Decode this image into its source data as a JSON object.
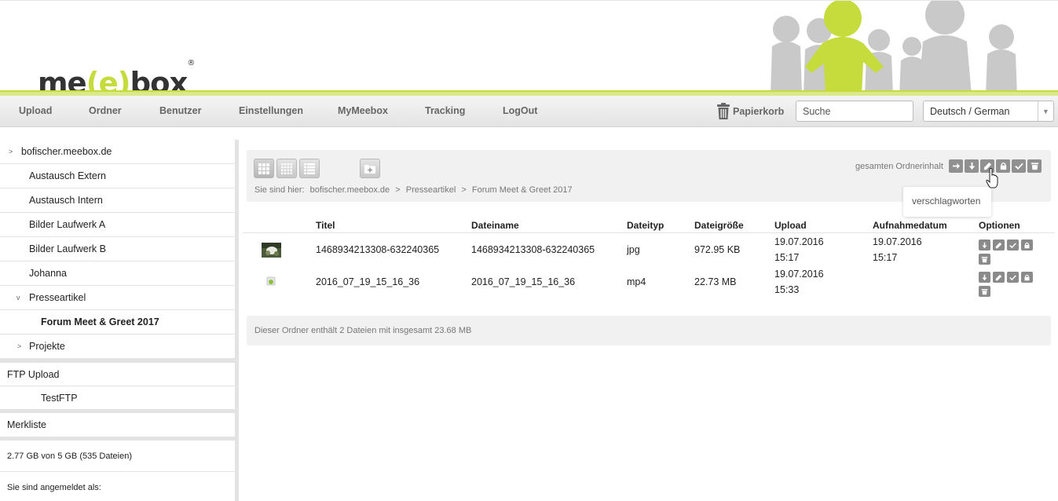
{
  "brand": {
    "logo_part1": "me",
    "logo_part2": "(e)",
    "logo_part3": "box",
    "logo_mark": "®",
    "accent_color": "#c6dc3c"
  },
  "nav": {
    "items": [
      "Upload",
      "Ordner",
      "Benutzer",
      "Einstellungen",
      "MyMeebox",
      "Tracking",
      "LogOut"
    ],
    "trash_label": "Papierkorb",
    "trash_icon": "trash-icon",
    "search_placeholder": "Suche",
    "language_value": "Deutsch / German"
  },
  "sidebar": {
    "root": "bofischer.meebox.de",
    "folders": [
      "Austausch Extern",
      "Austausch Intern",
      "Bilder Laufwerk A",
      "Bilder Laufwerk B",
      "Johanna",
      "Presseartikel",
      "Forum Meet & Greet 2017",
      "Projekte"
    ],
    "ftp_label": "FTP Upload",
    "ftp_child": "TestFTP",
    "merkliste": "Merkliste",
    "storage": "2.77 GB von 5 GB (535 Dateien)",
    "logged_in_label": "Sie sind angemeldet als:"
  },
  "toolbar": {
    "view_buttons": [
      "grid-large-icon",
      "grid-small-icon",
      "list-icon"
    ],
    "new_folder_icon": "folder-add-icon",
    "breadcrumb_prefix": "Sie sind hier:",
    "breadcrumb": [
      "bofischer.meebox.de",
      "Presseartikel",
      "Forum Meet & Greet 2017"
    ],
    "breadcrumb_sep": ">",
    "all_content_label": "gesamten Ordnerinhalt",
    "actions": [
      "move-icon",
      "download-icon",
      "edit-icon",
      "lock-icon",
      "check-icon",
      "delete-icon"
    ],
    "tooltip": "verschlagworten"
  },
  "table": {
    "columns": [
      "Titel",
      "Dateiname",
      "Dateityp",
      "Dateigröße",
      "Upload",
      "Aufnahmedatum",
      "Optionen"
    ],
    "rows": [
      {
        "thumb": "image-thumbnail",
        "title": "1468934213308-632240365",
        "filename": "1468934213308-632240365",
        "type": "jpg",
        "size": "972.95 KB",
        "upload_date": "19.07.2016",
        "upload_time": "15:17",
        "capture_date": "19.07.2016",
        "capture_time": "15:17"
      },
      {
        "thumb": "video-file-icon",
        "title": "2016_07_19_15_16_36",
        "filename": "2016_07_19_15_16_36",
        "type": "mp4",
        "size": "22.73 MB",
        "upload_date": "19.07.2016",
        "upload_time": "15:33",
        "capture_date": "",
        "capture_time": ""
      }
    ],
    "row_actions": [
      "download-icon",
      "edit-icon",
      "check-icon",
      "lock-icon",
      "delete-icon"
    ]
  },
  "footer": {
    "folder_info": "Dieser Ordner enthält 2 Dateien mit insgesamt 23.68 MB"
  }
}
